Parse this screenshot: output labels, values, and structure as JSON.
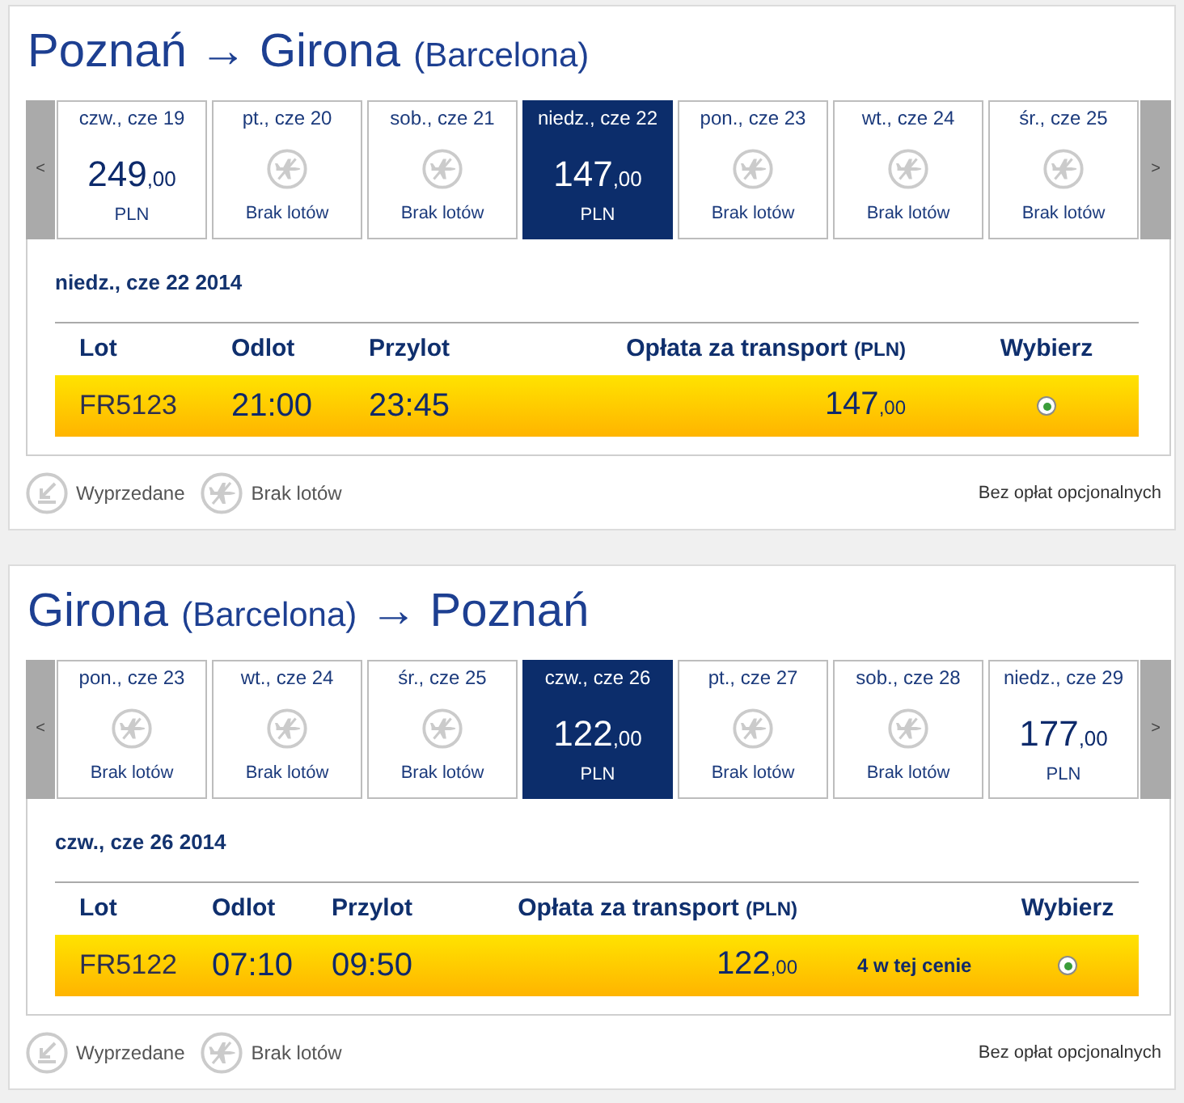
{
  "journeys": [
    {
      "title": [
        {
          "text": "Poznań → Girona",
          "kind": "main"
        },
        {
          "text": "(Barcelona)",
          "kind": "note"
        }
      ],
      "date_strip": {
        "prev": "<",
        "next": ">",
        "days": [
          {
            "label": "czw., cze 19",
            "selected": false,
            "kind": "fare",
            "price": "249",
            "decimals": ",00",
            "currency": "PLN"
          },
          {
            "label": "pt., cze 20",
            "selected": false,
            "kind": "no_flights",
            "status": "Brak lotów"
          },
          {
            "label": "sob., cze 21",
            "selected": false,
            "kind": "no_flights",
            "status": "Brak lotów"
          },
          {
            "label": "niedz., cze 22",
            "selected": true,
            "kind": "fare",
            "price": "147",
            "decimals": ",00",
            "currency": "PLN"
          },
          {
            "label": "pon., cze 23",
            "selected": false,
            "kind": "no_flights",
            "status": "Brak lotów"
          },
          {
            "label": "wt., cze 24",
            "selected": false,
            "kind": "no_flights",
            "status": "Brak lotów"
          },
          {
            "label": "śr., cze 25",
            "selected": false,
            "kind": "no_flights",
            "status": "Brak lotów"
          }
        ]
      },
      "selected_date": "niedz., cze 22 2014",
      "table": {
        "columns": [
          {
            "label": "Lot"
          },
          {
            "label": "Odlot"
          },
          {
            "label": "Przylot"
          },
          {
            "label": "Opłata za transport",
            "unit": "(PLN)"
          },
          {
            "label": "Wybierz"
          }
        ],
        "rows": [
          {
            "flight": "FR5123",
            "departure": "21:00",
            "arrival": "23:45",
            "price": "147",
            "decimals": ",00",
            "selected": true
          }
        ]
      },
      "legend": [
        {
          "kind": "sold_out",
          "label": "Wyprzedane"
        },
        {
          "kind": "no_flights",
          "label": "Brak lotów"
        }
      ],
      "note": "Bez opłat opcjonalnych"
    },
    {
      "title": [
        {
          "text": "Girona",
          "kind": "main"
        },
        {
          "text": "(Barcelona)",
          "kind": "note"
        },
        {
          "text": "→ Poznań",
          "kind": "main"
        }
      ],
      "date_strip": {
        "prev": "<",
        "next": ">",
        "days": [
          {
            "label": "pon., cze 23",
            "selected": false,
            "kind": "no_flights",
            "status": "Brak lotów"
          },
          {
            "label": "wt., cze 24",
            "selected": false,
            "kind": "no_flights",
            "status": "Brak lotów"
          },
          {
            "label": "śr., cze 25",
            "selected": false,
            "kind": "no_flights",
            "status": "Brak lotów"
          },
          {
            "label": "czw., cze 26",
            "selected": true,
            "kind": "fare",
            "price": "122",
            "decimals": ",00",
            "currency": "PLN"
          },
          {
            "label": "pt., cze 27",
            "selected": false,
            "kind": "no_flights",
            "status": "Brak lotów"
          },
          {
            "label": "sob., cze 28",
            "selected": false,
            "kind": "no_flights",
            "status": "Brak lotów"
          },
          {
            "label": "niedz., cze 29",
            "selected": false,
            "kind": "fare",
            "price": "177",
            "decimals": ",00",
            "currency": "PLN"
          }
        ]
      },
      "selected_date": "czw., cze 26 2014",
      "table": {
        "columns": [
          {
            "label": "Lot"
          },
          {
            "label": "Odlot"
          },
          {
            "label": "Przylot"
          },
          {
            "label": "Opłata za transport",
            "unit": "(PLN)"
          },
          {
            "label": "Wybierz"
          }
        ],
        "rows": [
          {
            "flight": "FR5122",
            "departure": "07:10",
            "arrival": "09:50",
            "price": "122",
            "decimals": ",00",
            "note": "4 w tej cenie",
            "selected": true
          }
        ]
      },
      "legend": [
        {
          "kind": "sold_out",
          "label": "Wyprzedane"
        },
        {
          "kind": "no_flights",
          "label": "Brak lotów"
        }
      ],
      "note": "Bez opłat opcjonalnych"
    }
  ]
}
